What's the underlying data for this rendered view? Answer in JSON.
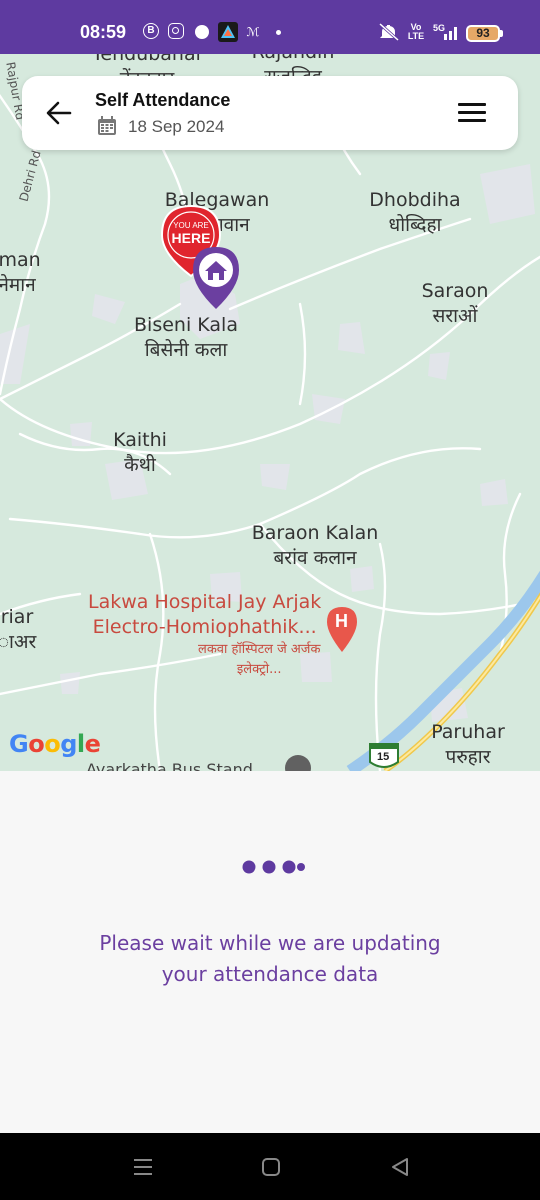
{
  "status_bar": {
    "time": "08:59",
    "network": "Vo LTE",
    "signal": "5G",
    "battery": "93"
  },
  "header": {
    "title": "Self Attendance",
    "date": "18 Sep 2024"
  },
  "map": {
    "places": [
      {
        "en": "Balegawan",
        "hi": "बलेगावान"
      },
      {
        "en": "Dhobdiha",
        "hi": "धोब्दिहा"
      },
      {
        "en": "Saraon",
        "hi": "सराओं"
      },
      {
        "en": "Biseni Kala",
        "hi": "बिसेनी कला"
      },
      {
        "en": "Kaithi",
        "hi": "कैथी"
      },
      {
        "en": "Baraon Kalan",
        "hi": "बरांव कलान"
      },
      {
        "en": "Paruhar",
        "hi": "परुहार"
      },
      {
        "en": "iman",
        "hi": "नेमान"
      },
      {
        "en": "riar",
        "hi": "ाअर"
      },
      {
        "en": "Tendubahar",
        "hi": "तेंदुबहार"
      },
      {
        "en": "Rajandih",
        "hi": "राजन्दिह"
      }
    ],
    "hospital_en": "Lakwa Hospital Jay Arjak\nElectro-Homiophathik...",
    "hospital_hi": "लकवा हॉस्पिटल जे अर्जक\nइलेक्ट्रो...",
    "bus_stand": "Ayarkatha Bus Stand",
    "roads": [
      "Rajpur Rd",
      "Dehri Rd"
    ],
    "highway": "15",
    "you_are_here_top": "YOU ARE",
    "you_are_here_main": "HERE",
    "hospital_marker": "H"
  },
  "status_message": "Please wait while we are updating\nyour attendance data",
  "colors": {
    "brand": "#5e3aa0",
    "accent": "#6b3fa0",
    "marker_red": "#e0252e"
  }
}
